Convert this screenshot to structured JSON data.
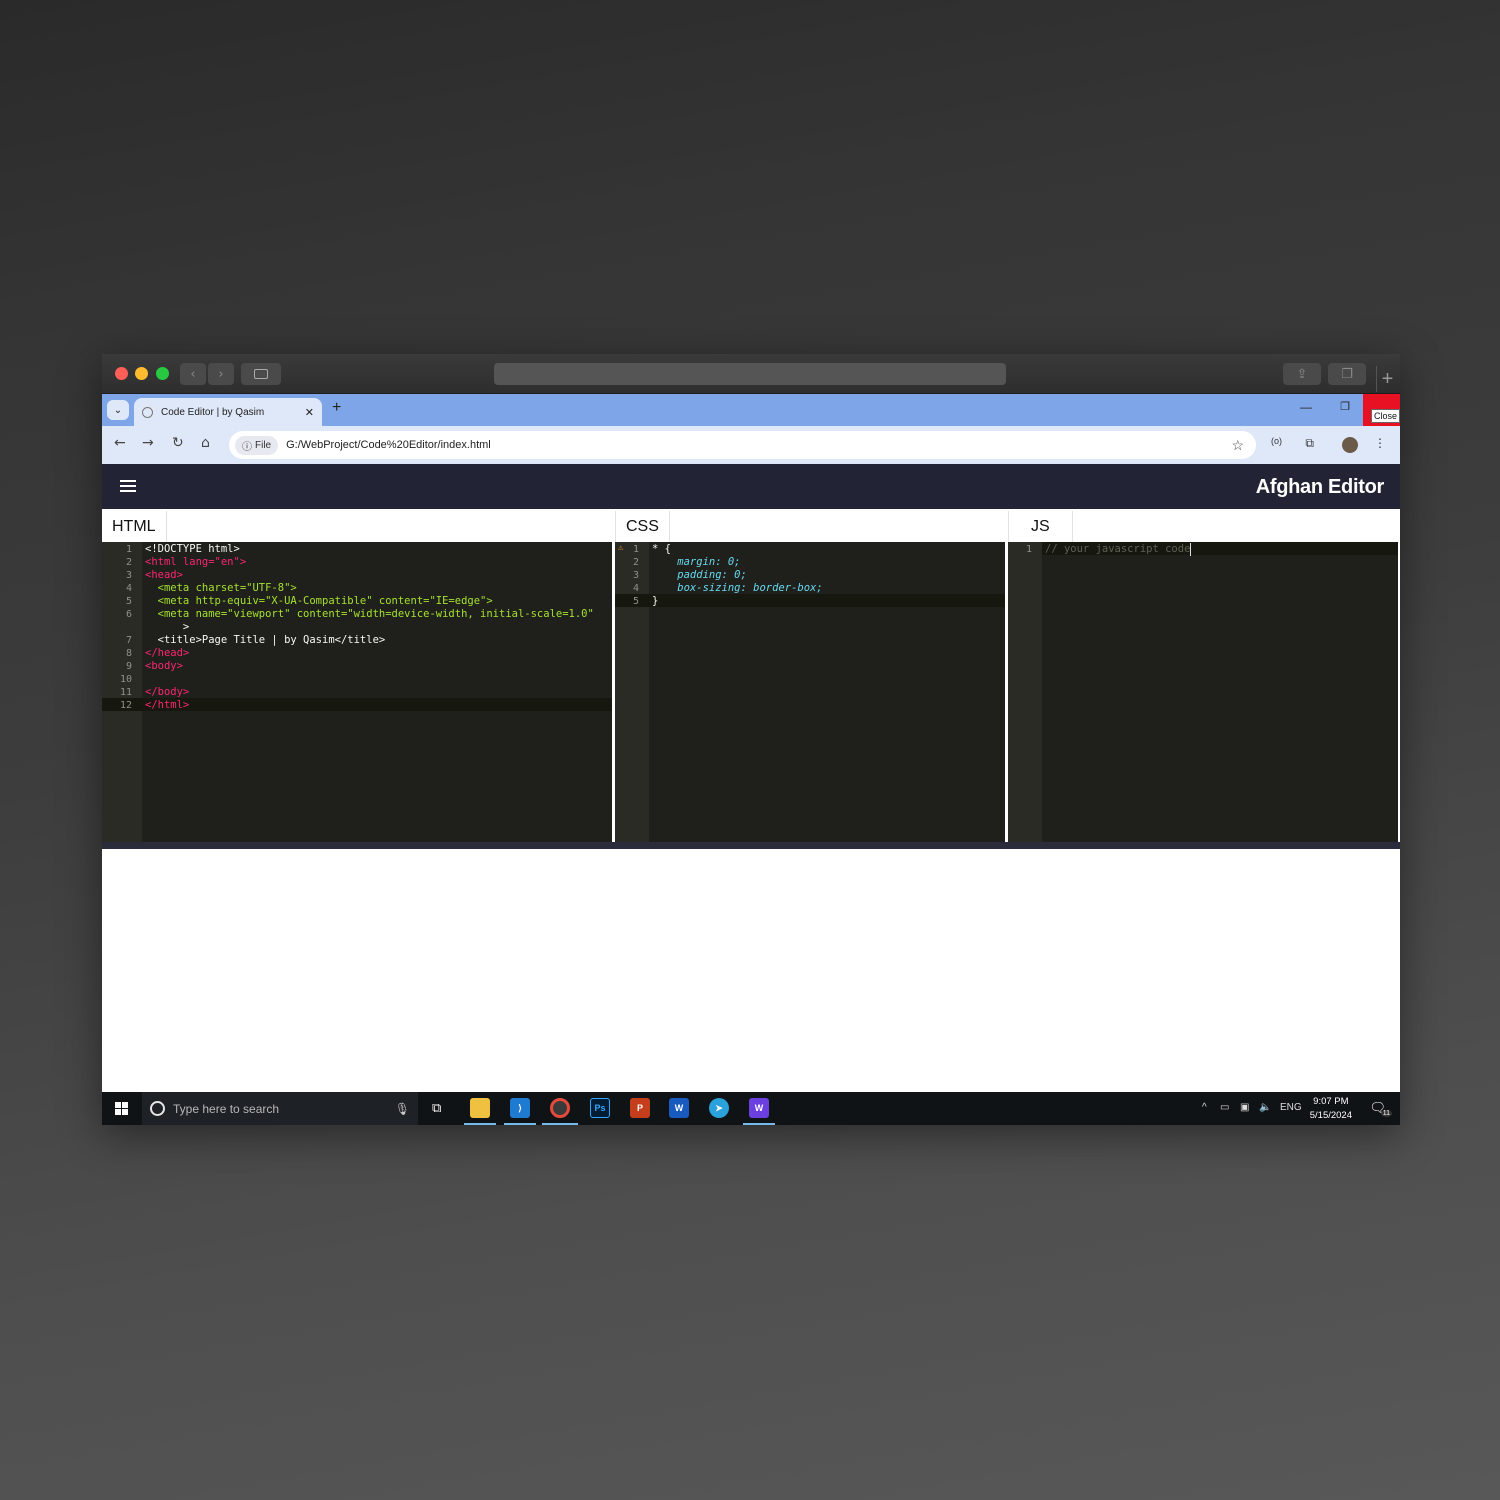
{
  "mac": {
    "back_icon": "chevron-left",
    "forward_icon": "chevron-right",
    "sidebar_icon": "sidebar",
    "share_icon": "share",
    "tabs_icon": "tabs",
    "plus": "+"
  },
  "browser": {
    "tab_title": "Code Editor | by Qasim",
    "tab_close": "✕",
    "new_tab": "+",
    "minimize": "—",
    "maximize": "❐",
    "close_tooltip": "Close",
    "address_chip": "File",
    "url": "G:/WebProject/Code%20Editor/index.html"
  },
  "app": {
    "brand": "Afghan Editor",
    "accent": "#232336"
  },
  "panes": {
    "html": {
      "label": "HTML",
      "line_numbers": [
        "1",
        "2",
        "3",
        "4",
        "5",
        "6",
        "",
        "7",
        "8",
        "9",
        "10",
        "11",
        "12"
      ],
      "lines": [
        "<!DOCTYPE html>",
        "<html lang=\"en\">",
        "<head>",
        "  <meta charset=\"UTF-8\">",
        "  <meta http-equiv=\"X-UA-Compatible\" content=\"IE=edge\">",
        "  <meta name=\"viewport\" content=\"width=device-width, initial-scale=1.0\"",
        "      >",
        "  <title>Page Title | by Qasim</title>",
        "</head>",
        "<body>",
        "",
        "</body>",
        "</html>"
      ]
    },
    "css": {
      "label": "CSS",
      "line_numbers": [
        "1",
        "2",
        "3",
        "4",
        "5"
      ],
      "lines": [
        "* {",
        "    margin: 0;",
        "    padding: 0;",
        "    box-sizing: border-box;",
        "}"
      ]
    },
    "js": {
      "label": "JS",
      "line_numbers": [
        "1"
      ],
      "lines": [
        "// your javascript code"
      ]
    }
  },
  "taskbar": {
    "search_placeholder": "Type here to search",
    "language": "ENG",
    "time": "9:07 PM",
    "date": "5/15/2024",
    "notification_count": "11"
  }
}
